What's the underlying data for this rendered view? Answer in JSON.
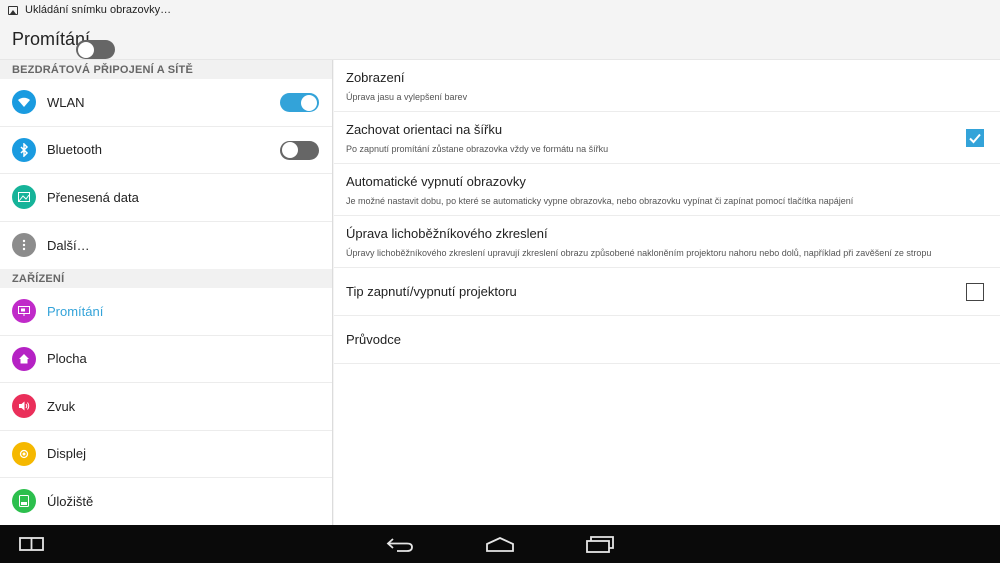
{
  "status_bar": {
    "notification_text": "Ukládání snímku obrazovky…",
    "icon": "image-icon"
  },
  "action_bar": {
    "title": "Promítání",
    "master_toggle": "off"
  },
  "sidebar": {
    "sections": [
      {
        "header": "BEZDRÁTOVÁ PŘIPOJENÍ A SÍTĚ",
        "items": [
          {
            "label": "WLAN",
            "icon": "wifi-icon",
            "color": "#1a9be0",
            "toggle": "on"
          },
          {
            "label": "Bluetooth",
            "icon": "bluetooth-icon",
            "color": "#1a9be0",
            "toggle": "off"
          },
          {
            "label": "Přenesená data",
            "icon": "data-usage-icon",
            "color": "#16b399"
          },
          {
            "label": "Další…",
            "icon": "more-icon",
            "color": "#8c8c8c"
          }
        ]
      },
      {
        "header": "ZAŘÍZENÍ",
        "items": [
          {
            "label": "Promítání",
            "icon": "projector-icon",
            "color": "#c02ac9",
            "active": true
          },
          {
            "label": "Plocha",
            "icon": "home-icon",
            "color": "#b522c4"
          },
          {
            "label": "Zvuk",
            "icon": "volume-icon",
            "color": "#ea2f5a"
          },
          {
            "label": "Displej",
            "icon": "brightness-icon",
            "color": "#f5b800"
          },
          {
            "label": "Úložiště",
            "icon": "storage-icon",
            "color": "#2cbf4d"
          }
        ]
      }
    ]
  },
  "main": {
    "preferences": [
      {
        "title": "Zobrazení",
        "summary": "Úprava jasu a vylepšení barev"
      },
      {
        "title": "Zachovat orientaci na šířku",
        "summary": "Po zapnutí promítání zůstane obrazovka vždy ve formátu na šířku",
        "checkbox": true
      },
      {
        "title": "Automatické vypnutí obrazovky",
        "summary": "Je možné nastavit dobu, po které se automaticky vypne obrazovka, nebo obrazovku vypínat či zapínat pomocí tlačítka napájení"
      },
      {
        "title": "Úprava lichoběžníkového zkreslení",
        "summary": "Úpravy lichoběžníkového zkreslení upravují zkreslení obrazu způsobené nakloněním projektoru nahoru nebo dolů, například při zavěšení ze stropu"
      },
      {
        "title": "Tip zapnutí/vypnutí projektoru",
        "checkbox": false
      },
      {
        "title": "Průvodce"
      }
    ]
  },
  "nav_bar": {
    "buttons": [
      "split-screen-icon",
      "back-icon",
      "home-icon",
      "recents-icon"
    ]
  },
  "colors": {
    "accent": "#33a3d9",
    "toggle_off": "#666666",
    "nav_bar": "#0a0a0a"
  }
}
